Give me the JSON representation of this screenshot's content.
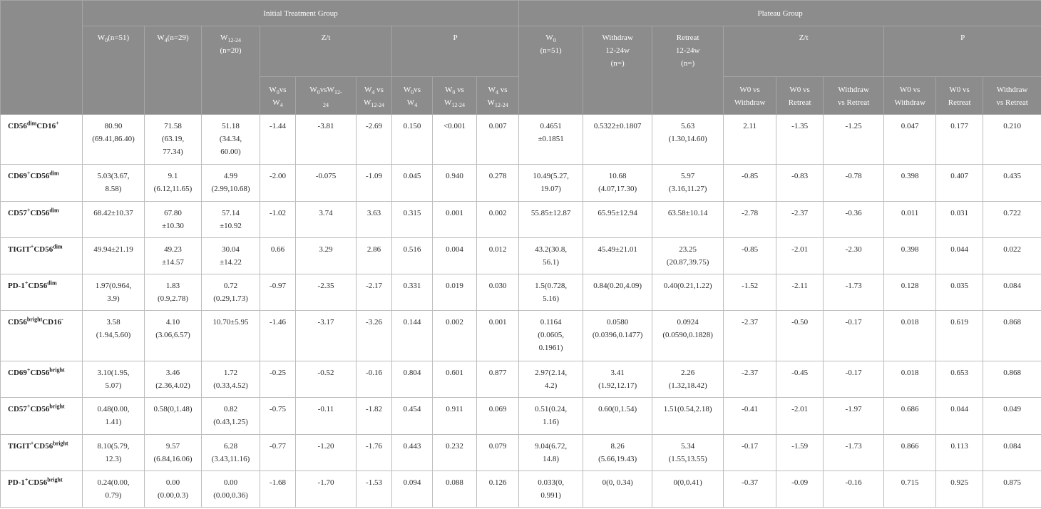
{
  "header": {
    "group1": "Initial Treatment Group",
    "group2": "Plateau Group",
    "row2": [
      "W<sub>0</sub>(n=51)",
      "W<sub>4</sub>(n=29)",
      "W<sub>12-24</sub><br>(n=20)",
      "Z/t",
      "P",
      "W<sub>0</sub><br>(n=51)",
      "Withdraw<br>12-24w<br>(n=)",
      "Retreat<br>12-24w<br>(n=)",
      "Z/t",
      "P"
    ],
    "row3": [
      "W<sub>0</sub>vs<br>W<sub>4</sub>",
      "W<sub>0</sub>vsW<sub>12-</sub><br><sub>24</sub>",
      "W<sub>4</sub> vs<br>W<sub>12-24</sub>",
      "W<sub>0</sub>vs<br>W<sub>4</sub>",
      "W<sub>0</sub> vs<br>W<sub>12-24</sub>",
      "W<sub>4</sub> vs<br>W<sub>12-24</sub>",
      "W0 vs<br>Withdraw",
      "W0 vs<br>Retreat",
      "Withdraw<br>vs Retreat",
      "W0 vs<br>Withdraw",
      "W0 vs<br>Retreat",
      "Withdraw<br>vs Retreat"
    ]
  },
  "rows": [
    {
      "label": "CD56<sup>dim</sup>CD16<sup>+</sup>",
      "cells": [
        "80.90<br>(69.41,86.40)",
        "71.58<br>(63.19,<br>77.34)",
        "51.18<br>(34.34,<br>60.00)",
        "-1.44",
        "-3.81",
        "-2.69",
        "0.150",
        "&lt;0.001",
        "0.007",
        "0.4651<br>±0.1851",
        "0.5322±0.1807",
        "5.63<br>(1.30,14.60)",
        "2.11",
        "-1.35",
        "-1.25",
        "0.047",
        "0.177",
        "0.210"
      ]
    },
    {
      "label": "CD69<sup>+</sup>CD56<sup>dim</sup>",
      "cells": [
        "5.03(3.67,<br>8.58)",
        "9.1<br>(6.12,11.65)",
        "4.99<br>(2.99,10.68)",
        "-2.00",
        "-0.075",
        "-1.09",
        "0.045",
        "0.940",
        "0.278",
        "10.49(5.27,<br>19.07)",
        "10.68<br>(4.07,17.30)",
        "5.97<br>(3.16,11.27)",
        "-0.85",
        "-0.83",
        "-0.78",
        "0.398",
        "0.407",
        "0.435"
      ]
    },
    {
      "label": "CD57<sup>+</sup>CD56<sup>dim</sup>",
      "cells": [
        "68.42±10.37",
        "67.80<br>±10.30",
        "57.14<br>±10.92",
        "-1.02",
        "3.74",
        "3.63",
        "0.315",
        "0.001",
        "0.002",
        "55.85±12.87",
        "65.95±12.94",
        "63.58±10.14",
        "-2.78",
        "-2.37",
        "-0.36",
        "0.011",
        "0.031",
        "0.722"
      ]
    },
    {
      "label": "TIGIT<sup>+</sup>CD56<sup>dim</sup>",
      "cells": [
        "49.94±21.19",
        "49.23<br>±14.57",
        "30.04<br>±14.22",
        "0.66",
        "3.29",
        "2.86",
        "0.516",
        "0.004",
        "0.012",
        "43.2(30.8,<br>56.1)",
        "45.49±21.01",
        "23.25<br>(20.87,39.75)",
        "-0.85",
        "-2.01",
        "-2.30",
        "0.398",
        "0.044",
        "0.022"
      ]
    },
    {
      "label": "PD-1<sup>+</sup>CD56<sup>dim</sup>",
      "cells": [
        "1.97(0.964,<br>3.9)",
        "1.83<br>(0.9,2.78)",
        "0.72<br>(0.29,1.73)",
        "-0.97",
        "-2.35",
        "-2.17",
        "0.331",
        "0.019",
        "0.030",
        "1.5(0.728,<br>5.16)",
        "0.84(0.20,4.09)",
        "0.40(0.21,1.22)",
        "-1.52",
        "-2.11",
        "-1.73",
        "0.128",
        "0.035",
        "0.084"
      ]
    },
    {
      "label": "CD56<sup>bright</sup>CD16<sup>-</sup>",
      "cells": [
        "3.58<br>(1.94,5.60)",
        "4.10<br>(3.06,6.57)",
        "10.70±5.95",
        "-1.46",
        "-3.17",
        "-3.26",
        "0.144",
        "0.002",
        "0.001",
        "0.1164<br>(0.0605,<br>0.1961)",
        "0.0580<br>(0.0396,0.1477)",
        "0.0924<br>(0.0590,0.1828)",
        "-2.37",
        "-0.50",
        "-0.17",
        "0.018",
        "0.619",
        "0.868"
      ]
    },
    {
      "label": "CD69<sup>+</sup>CD56<sup>bright</sup>",
      "cells": [
        "3.10(1.95,<br>5.07)",
        "3.46<br>(2.36,4.02)",
        "1.72<br>(0.33,4.52)",
        "-0.25",
        "-0.52",
        "-0.16",
        "0.804",
        "0.601",
        "0.877",
        "2.97(2.14,<br>4.2)",
        "3.41<br>(1.92,12.17)",
        "2.26<br>(1.32,18.42)",
        "-2.37",
        "-0.45",
        "-0.17",
        "0.018",
        "0.653",
        "0.868"
      ]
    },
    {
      "label": "CD57<sup>+</sup>CD56<sup>bright</sup>",
      "cells": [
        "0.48(0.00,<br>1.41)",
        "0.58(0,1.48)",
        "0.82<br>(0.43,1.25)",
        "-0.75",
        "-0.11",
        "-1.82",
        "0.454",
        "0.911",
        "0.069",
        "0.51(0.24,<br>1.16)",
        "0.60(0,1.54)",
        "1.51(0.54,2.18)",
        "-0.41",
        "-2.01",
        "-1.97",
        "0.686",
        "0.044",
        "0.049"
      ]
    },
    {
      "label": "TIGIT<sup>+</sup>CD56<sup>bright</sup>",
      "cells": [
        "8.10(5.79,<br>12.3)",
        "9.57<br>(6.84,16.06)",
        "6.28<br>(3.43,11.16)",
        "-0.77",
        "-1.20",
        "-1.76",
        "0.443",
        "0.232",
        "0.079",
        "9.04(6.72,<br>14.8)",
        "8.26<br>(5.66,19.43)",
        "5.34<br>(1.55,13.55)",
        "-0.17",
        "-1.59",
        "-1.73",
        "0.866",
        "0.113",
        "0.084"
      ]
    },
    {
      "label": "PD-1<sup>+</sup>CD56<sup>bright</sup>",
      "cells": [
        "0.24(0.00,<br>0.79)",
        "0.00<br>(0.00,0.3)",
        "0.00<br>(0.00,0.36)",
        "-1.68",
        "-1.70",
        "-1.53",
        "0.094",
        "0.088",
        "0.126",
        "0.033(0,<br>0.991)",
        "0(0, 0.34)",
        "0(0,0.41)",
        "-0.37",
        "-0.09",
        "-0.16",
        "0.715",
        "0.925",
        "0.875"
      ]
    }
  ]
}
